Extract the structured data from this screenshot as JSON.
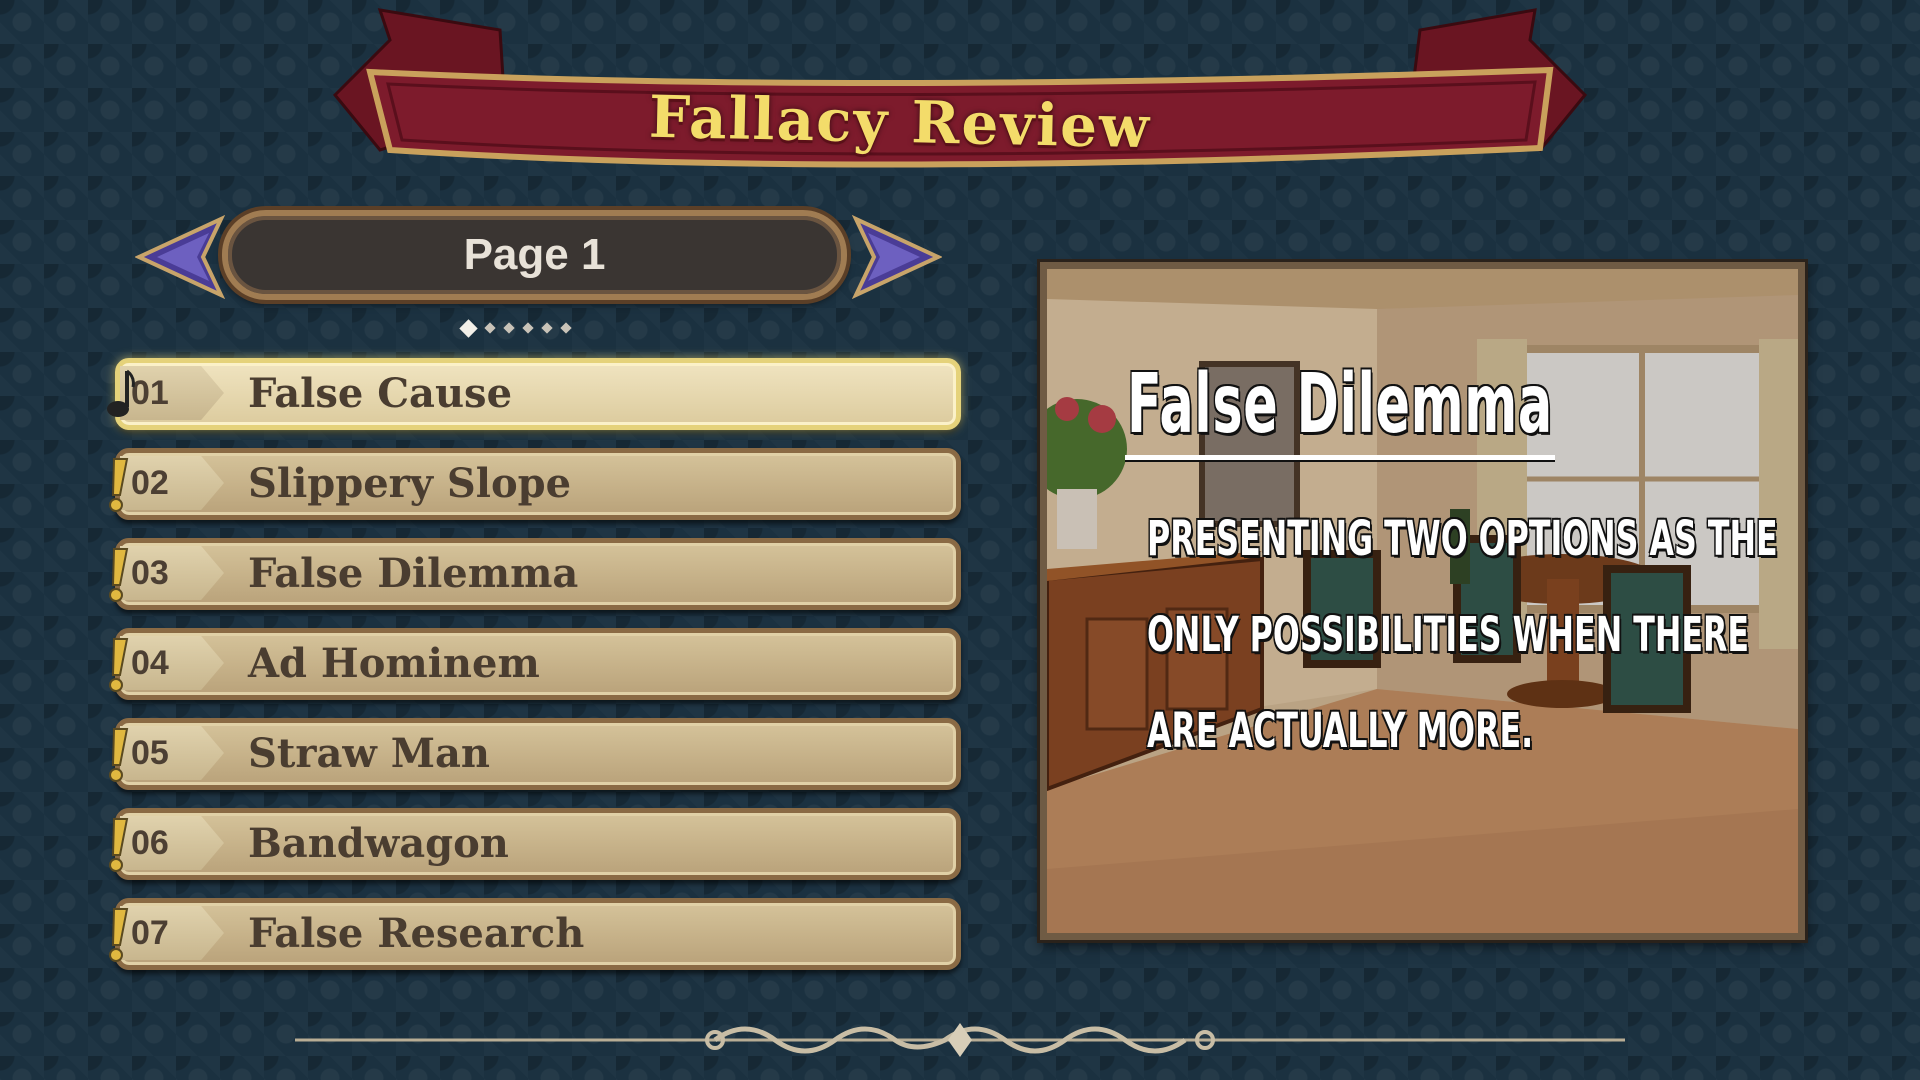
{
  "title": "Fallacy Review",
  "page": {
    "label": "Page 1",
    "dots_total": 6,
    "active_index": 0
  },
  "items": [
    {
      "num": "01",
      "label": "False Cause",
      "selected": true,
      "mark": "music-note-icon"
    },
    {
      "num": "02",
      "label": "Slippery Slope",
      "selected": false,
      "mark": "exclamation-icon"
    },
    {
      "num": "03",
      "label": "False Dilemma",
      "selected": false,
      "mark": "exclamation-icon"
    },
    {
      "num": "04",
      "label": "Ad Hominem",
      "selected": false,
      "mark": "exclamation-icon"
    },
    {
      "num": "05",
      "label": "Straw Man",
      "selected": false,
      "mark": "exclamation-icon"
    },
    {
      "num": "06",
      "label": "Bandwagon",
      "selected": false,
      "mark": "exclamation-icon"
    },
    {
      "num": "07",
      "label": "False Research",
      "selected": false,
      "mark": "exclamation-icon"
    }
  ],
  "detail": {
    "title": "False Dilemma",
    "description": "Presenting two options as the only possibilities when there are actually more."
  },
  "colors": {
    "banner": "#7a1a2a",
    "title_gold": "#f3dc6a",
    "arrow": "#4b3f9a",
    "plate": "#c8b48a",
    "selected_border": "#e5d27a"
  }
}
